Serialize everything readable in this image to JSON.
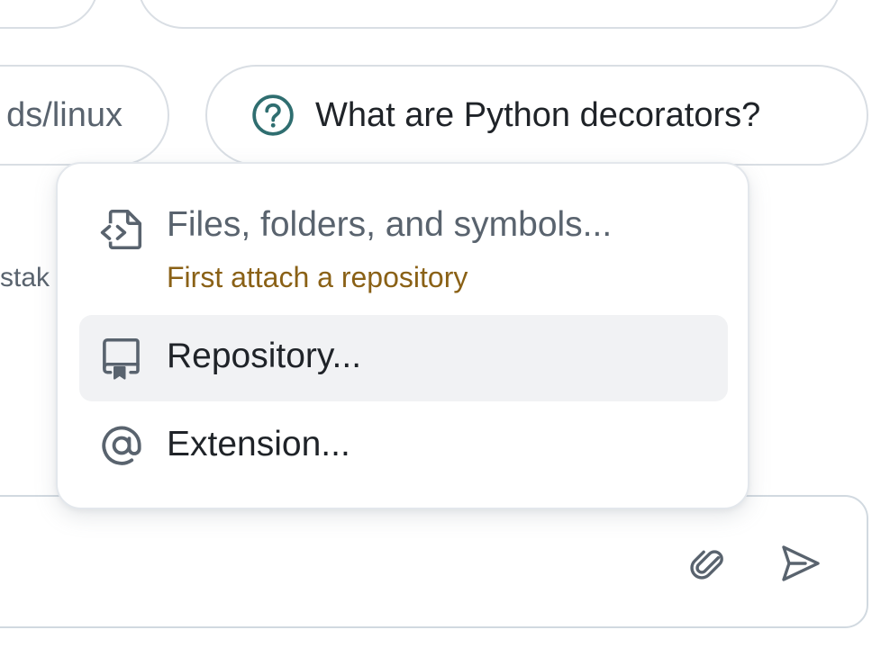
{
  "suggestions": {
    "left_partial": "ds/linux",
    "python": "What are Python decorators?"
  },
  "background_partial_text": "stak",
  "menu": {
    "files": {
      "label": "Files, folders, and symbols...",
      "hint": "First attach a repository",
      "icon": "file-code-icon"
    },
    "repository": {
      "label": "Repository...",
      "icon": "repo-icon"
    },
    "extension": {
      "label": "Extension...",
      "icon": "at-sign-icon"
    }
  },
  "composer": {
    "attach_icon": "paperclip-icon",
    "send_icon": "send-icon"
  },
  "colors": {
    "hint_warning": "#8a6116",
    "question_icon": "#2f6e70",
    "selected_item_bg": "#f1f2f4",
    "muted_text": "#59636e",
    "primary_text": "#1f2328"
  }
}
